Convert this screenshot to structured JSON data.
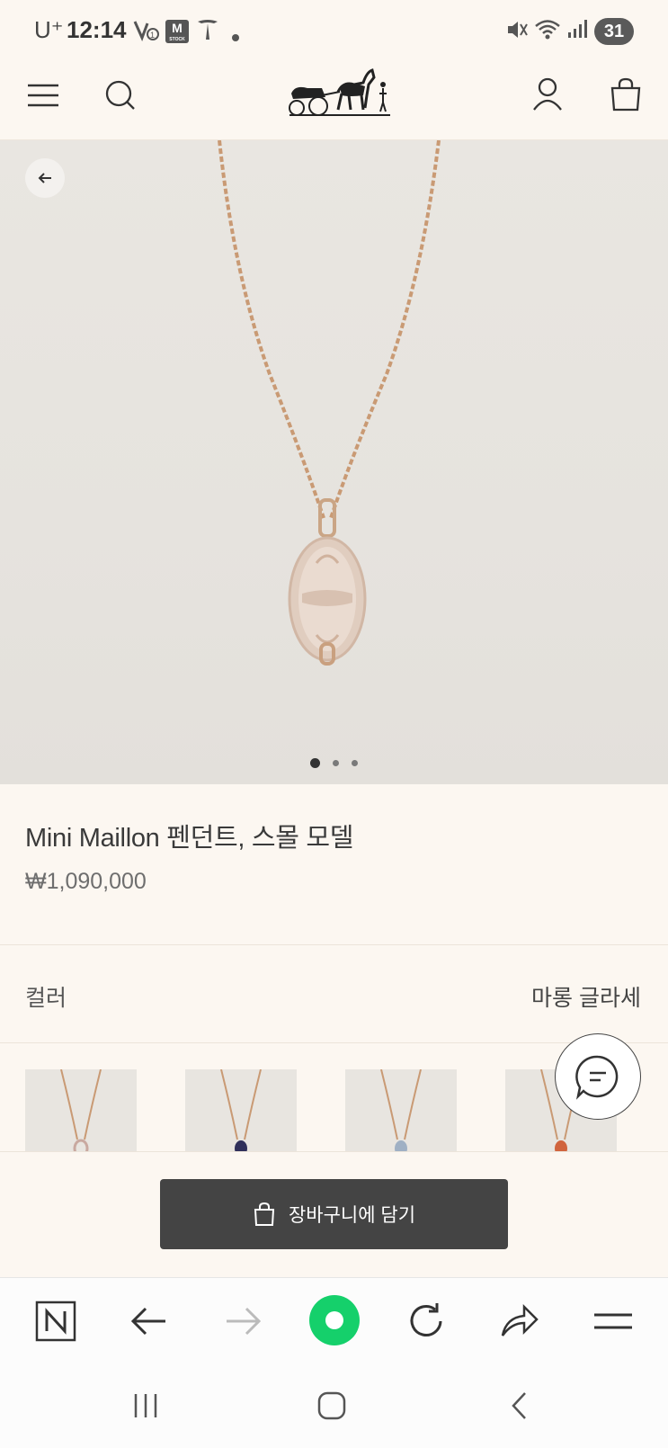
{
  "status_bar": {
    "carrier": "U⁺",
    "time": "12:14",
    "stock_badge": "M",
    "stock_badge_sub": "STOCK",
    "battery": "31"
  },
  "product": {
    "title": "Mini Maillon 펜던트, 스몰 모델",
    "price": "₩1,090,000",
    "image_index_total": 3,
    "image_index_active": 1
  },
  "color": {
    "label": "컬러",
    "value": "마롱 글라세",
    "swatch_accents": [
      "#c9a9a0",
      "#2f2f5a",
      "#9fb0c4",
      "#d0643e"
    ]
  },
  "cart_button": {
    "label": "장바구니에 담기"
  },
  "colors": {
    "background": "#fcf7f1",
    "cart_button": "#444444",
    "browser_green": "#15d06b",
    "chain": "#c99a74"
  },
  "icons": {
    "menu": "hamburger-icon",
    "search": "search-icon",
    "logo": "carriage-logo",
    "account": "user-icon",
    "bag": "shopping-bag-icon",
    "back": "arrow-left-icon",
    "chat": "chat-icon"
  }
}
